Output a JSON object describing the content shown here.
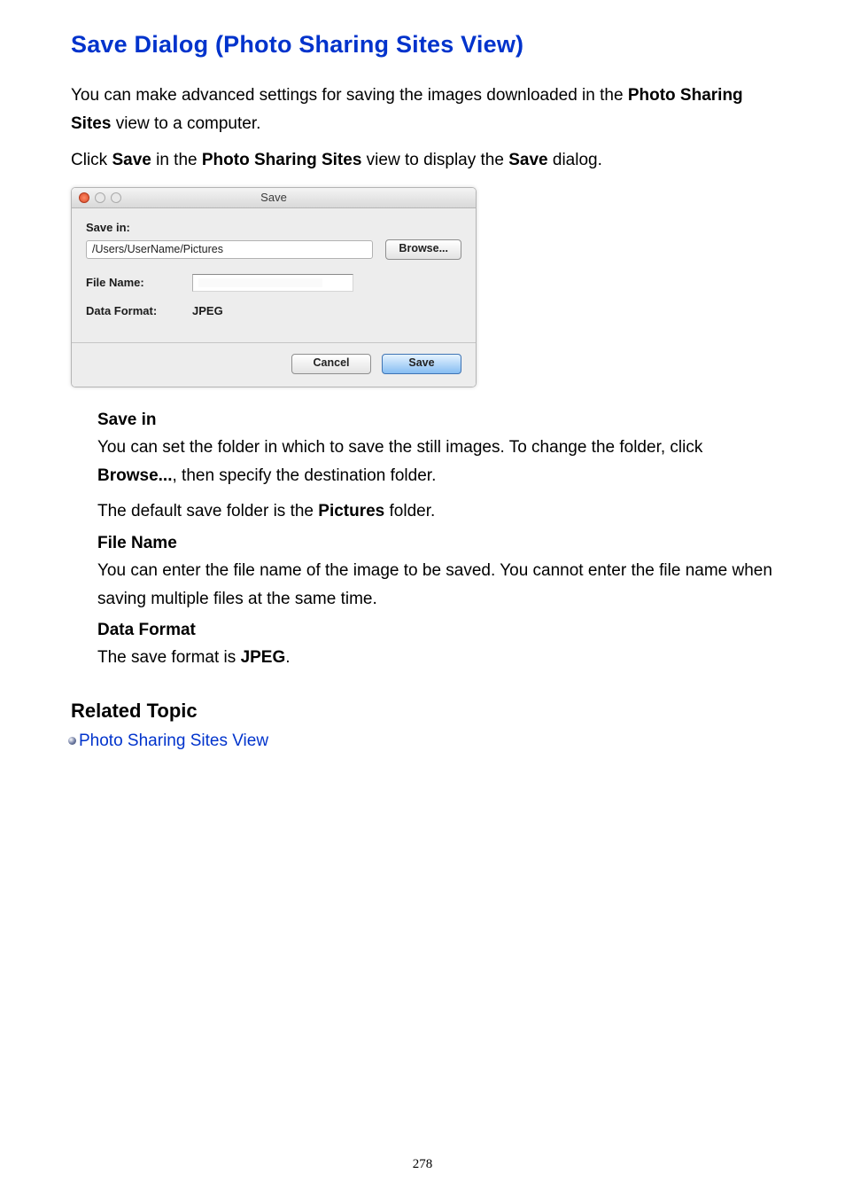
{
  "title": "Save Dialog (Photo Sharing Sites View)",
  "intro": {
    "p1_a": "You can make advanced settings for saving the images downloaded in the ",
    "p1_b": "Photo Sharing Sites",
    "p1_c": " view to a computer.",
    "p2_a": "Click ",
    "p2_b": "Save",
    "p2_c": " in the ",
    "p2_d": "Photo Sharing Sites",
    "p2_e": " view to display the ",
    "p2_f": "Save",
    "p2_g": " dialog."
  },
  "dialog": {
    "title": "Save",
    "save_in_label": "Save in:",
    "path": "/Users/UserName/Pictures",
    "browse": "Browse...",
    "file_name_label": "File Name:",
    "data_format_label": "Data Format:",
    "data_format_value": "JPEG",
    "cancel": "Cancel",
    "save": "Save"
  },
  "defs": {
    "save_in": {
      "term": "Save in",
      "d1_a": "You can set the folder in which to save the still images. To change the folder, click ",
      "d1_b": "Browse...",
      "d1_c": ", then specify the destination folder.",
      "d2_a": "The default save folder is the ",
      "d2_b": "Pictures",
      "d2_c": " folder."
    },
    "file_name": {
      "term": "File Name",
      "d": "You can enter the file name of the image to be saved. You cannot enter the file name when saving multiple files at the same time."
    },
    "data_format": {
      "term": "Data Format",
      "d_a": "The save format is ",
      "d_b": "JPEG",
      "d_c": "."
    }
  },
  "related": {
    "heading": "Related Topic",
    "link": "Photo Sharing Sites View"
  },
  "page_number": "278"
}
